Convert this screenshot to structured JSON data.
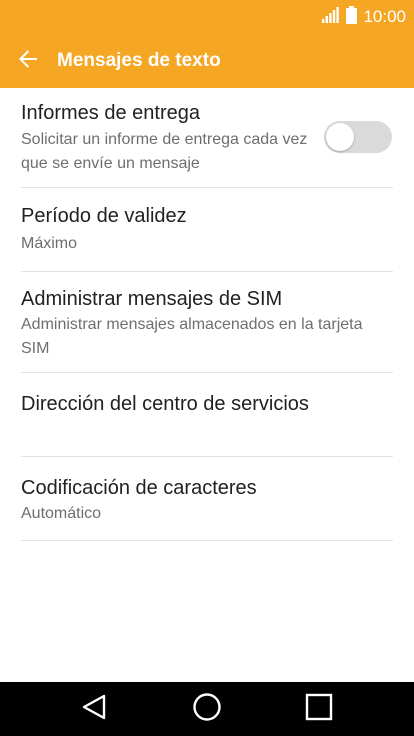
{
  "status_bar": {
    "time": "10:00",
    "signal_icon": "signal-icon",
    "battery_icon": "battery-icon"
  },
  "app_bar": {
    "title": "Mensajes de texto",
    "back_icon": "arrow-back-icon",
    "background_color": "#f5a623"
  },
  "settings": [
    {
      "title": "Informes de entrega",
      "summary": "Solicitar un informe de entrega cada vez que se envíe un mensaje",
      "toggle_on": false
    },
    {
      "title": "Período de validez",
      "summary": "Máximo"
    },
    {
      "title": "Administrar mensajes de SIM",
      "summary": "Administrar mensajes almacenados en la tarjeta SIM"
    },
    {
      "title": "Dirección del centro de servicios",
      "summary": ""
    },
    {
      "title": "Codificación de caracteres",
      "summary": "Automático"
    }
  ],
  "nav_bar": {
    "back_icon": "triangle-back-icon",
    "home_icon": "circle-home-icon",
    "recents_icon": "square-recents-icon"
  }
}
